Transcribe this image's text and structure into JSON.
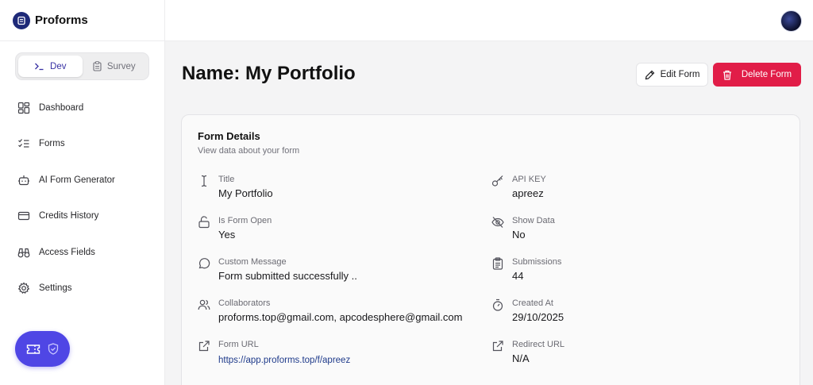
{
  "app": {
    "name": "Proforms"
  },
  "mode_switch": {
    "options": [
      "Dev",
      "Survey"
    ],
    "selected": "Dev"
  },
  "sidebar": {
    "items": [
      {
        "label": "Dashboard",
        "icon": "dashboard-icon"
      },
      {
        "label": "Forms",
        "icon": "list-check-icon"
      },
      {
        "label": "AI Form Generator",
        "icon": "bot-icon"
      },
      {
        "label": "Credits History",
        "icon": "credit-card-icon"
      },
      {
        "label": "Access Fields",
        "icon": "binoculars-icon"
      },
      {
        "label": "Settings",
        "icon": "gear-icon"
      }
    ]
  },
  "page": {
    "title": "Name: My Portfolio"
  },
  "actions": {
    "edit_label": "Edit Form",
    "delete_label": "Delete Form"
  },
  "card": {
    "title": "Form Details",
    "subtitle": "View data about your form",
    "left_fields": [
      {
        "label": "Title",
        "value": "My Portfolio",
        "icon": "text-cursor-icon"
      },
      {
        "label": "Is Form Open",
        "value": "Yes",
        "icon": "unlock-icon"
      },
      {
        "label": "Custom Message",
        "value": "Form submitted successfully ..",
        "icon": "message-circle-icon"
      },
      {
        "label": "Collaborators",
        "value": "proforms.top@gmail.com, apcodesphere@gmail.com",
        "icon": "users-icon"
      },
      {
        "label": "Form URL",
        "value": "https://app.proforms.top/f/apreez",
        "icon": "external-link-icon"
      }
    ],
    "right_fields": [
      {
        "label": "API KEY",
        "value": "apreez",
        "icon": "key-icon"
      },
      {
        "label": "Show Data",
        "value": "No",
        "icon": "eye-off-icon"
      },
      {
        "label": "Submissions",
        "value": "44",
        "icon": "clipboard-icon"
      },
      {
        "label": "Created At",
        "value": "29/10/2025",
        "icon": "timer-icon"
      },
      {
        "label": "Redirect URL",
        "value": "N/A",
        "icon": "external-link-icon"
      }
    ]
  },
  "colors": {
    "accent": "#4f46e5",
    "danger": "#e11d48",
    "link": "#1e3a8a",
    "logo": "#1e2a78"
  }
}
